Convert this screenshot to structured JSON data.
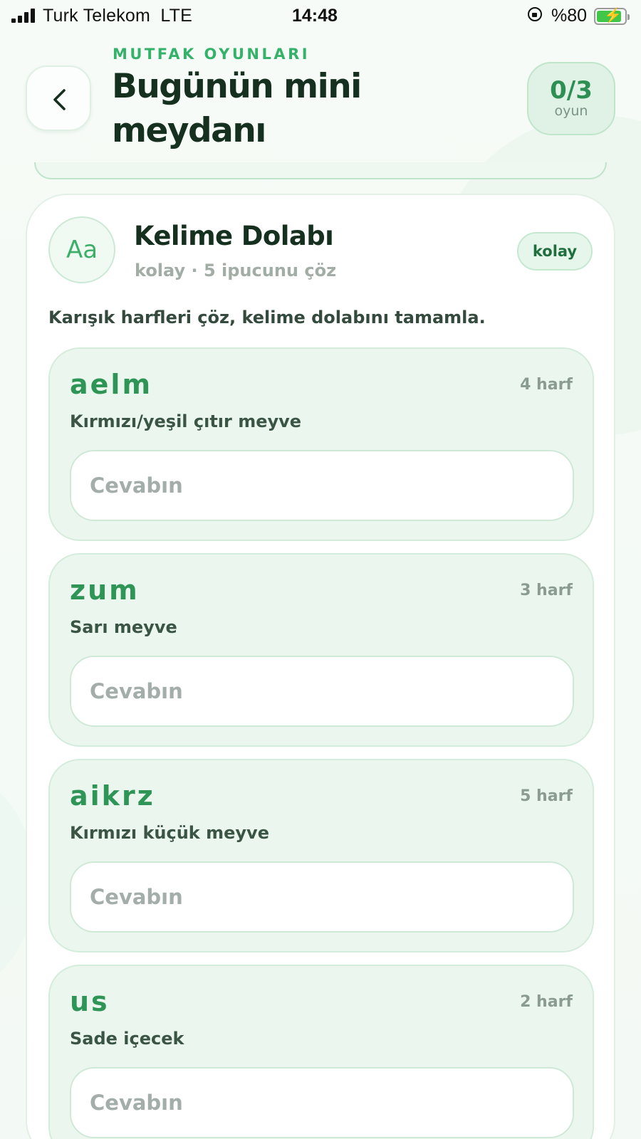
{
  "status_bar": {
    "carrier": "Turk Telekom",
    "network": "LTE",
    "time": "14:48",
    "battery_percent": "%80"
  },
  "header": {
    "back_icon": "chevron-left-icon",
    "eyebrow": "MUTFAK OYUNLARI",
    "title": "Bugünün mini meydanı",
    "score": "0/3",
    "score_label": "oyun"
  },
  "game": {
    "icon_text": "Aa",
    "title": "Kelime Dolabı",
    "subtitle": "kolay · 5 ipucunu çöz",
    "difficulty": "kolay",
    "description": "Karışık harfleri çöz, kelime dolabını tamamla."
  },
  "puzzles": [
    {
      "scrambled": "aelm",
      "length": "4 harf",
      "clue": "Kırmızı/yeşil çıtır meyve",
      "value": "",
      "placeholder": "Cevabın"
    },
    {
      "scrambled": "zum",
      "length": "3 harf",
      "clue": "Sarı meyve",
      "value": "",
      "placeholder": "Cevabın"
    },
    {
      "scrambled": "aikrz",
      "length": "5 harf",
      "clue": "Kırmızı küçük meyve",
      "value": "",
      "placeholder": "Cevabın"
    },
    {
      "scrambled": "us",
      "length": "2 harf",
      "clue": "Sade içecek",
      "value": "",
      "placeholder": "Cevabın"
    }
  ],
  "colors": {
    "accent": "#2e9556",
    "title": "#16301f",
    "puzzle_background": "#ebf7ee",
    "battery_fill": "#42c64a"
  }
}
